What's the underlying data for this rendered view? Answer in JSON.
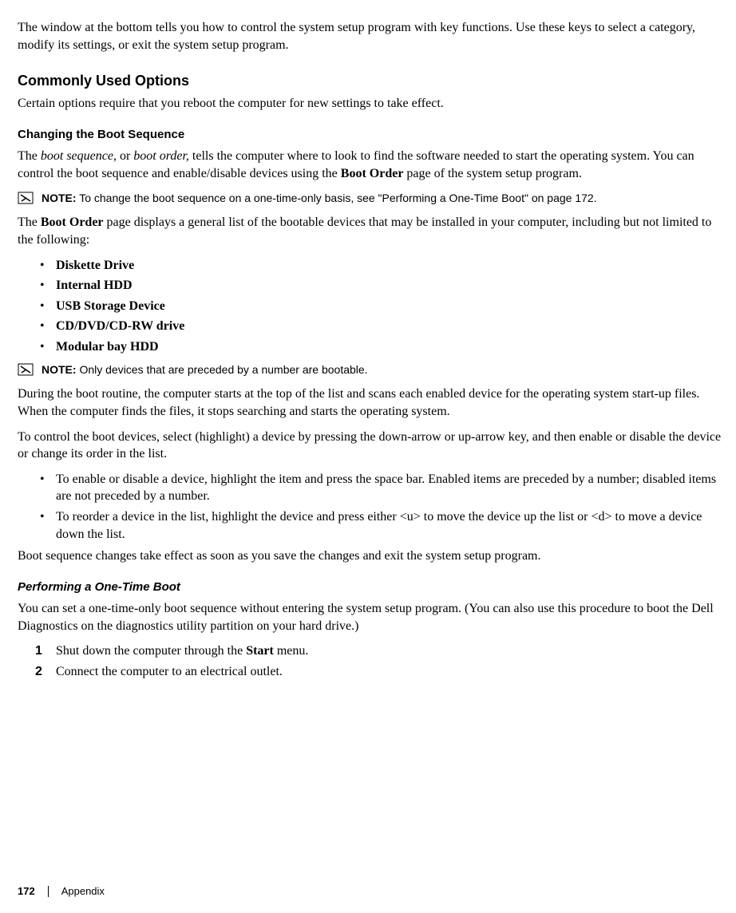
{
  "intro": "The window at the bottom tells you how to control the system setup program with key functions. Use these keys to select a category, modify its settings, or exit the system setup program.",
  "section1": {
    "heading": "Commonly Used Options",
    "p1": "Certain options require that you reboot the computer for new settings to take effect."
  },
  "section2": {
    "heading": "Changing the Boot Sequence",
    "p1_a": "The ",
    "p1_b": "boot sequence,",
    "p1_c": " or ",
    "p1_d": "boot order,",
    "p1_e": " tells the computer where to look to find the software needed to start the operating system. You can control the boot sequence and enable/disable devices using the ",
    "p1_f": "Boot Order",
    "p1_g": " page of the system setup program.",
    "note1_label": "NOTE:",
    "note1_text": " To change the boot sequence on a one-time-only basis, see \"Performing a One-Time Boot\" on page 172.",
    "p2_a": "The ",
    "p2_b": "Boot Order",
    "p2_c": " page displays a general list of the bootable devices that may be installed in your computer, including but not limited to the following:",
    "devices": [
      "Diskette Drive",
      "Internal HDD",
      "USB Storage Device",
      "CD/DVD/CD-RW drive",
      "Modular bay HDD"
    ],
    "note2_label": "NOTE:",
    "note2_text": " Only devices that are preceded by a number are bootable.",
    "p3": "During the boot routine, the computer starts at the top of the list and scans each enabled device for the operating system start-up files. When the computer finds the files, it stops searching and starts the operating system.",
    "p4": "To control the boot devices, select (highlight) a device by pressing the down-arrow or up-arrow key, and then enable or disable the device or change its order in the list.",
    "controls": [
      "To enable or disable a device, highlight the item and press the space bar. Enabled items are preceded by a number; disabled items are not preceded by a number.",
      "To reorder a device in the list, highlight the device and press either <u> to move the device up the list or <d> to move a device down the list."
    ],
    "p5": "Boot sequence changes take effect as soon as you save the changes and exit the system setup program."
  },
  "section3": {
    "heading": "Performing a One-Time Boot",
    "p1": "You can set a one-time-only boot sequence without entering the system setup program. (You can also use this procedure to boot the Dell Diagnostics on the diagnostics utility partition on your hard drive.)",
    "step1_a": "Shut down the computer through the ",
    "step1_b": "Start",
    "step1_c": " menu.",
    "step2": "Connect the computer to an electrical outlet."
  },
  "footer": {
    "page": "172",
    "section": "Appendix"
  }
}
